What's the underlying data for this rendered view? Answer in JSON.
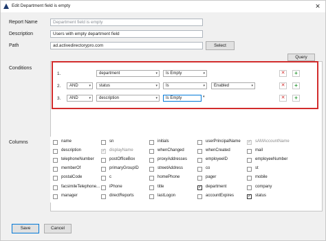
{
  "window": {
    "title": "Edit Department field is empty",
    "close_glyph": "✕"
  },
  "form": {
    "report_name_label": "Report Name",
    "report_name_value": "Department field is empty",
    "description_label": "Description",
    "description_value": "Users with empty department field",
    "path_label": "Path",
    "path_value": "ad.activedirectorypro.com",
    "select_button": "Select",
    "query_button": "Query",
    "conditions_label": "Conditions",
    "columns_label": "Columns"
  },
  "conditions": [
    {
      "num": "1.",
      "join": "",
      "field": "department",
      "operator": "Is Empty",
      "value": "",
      "value_type": "combo"
    },
    {
      "num": "2.",
      "join": "AND",
      "field": "status",
      "operator": "Is",
      "value": "Enabled",
      "value_type": "combo"
    },
    {
      "num": "3.",
      "join": "AND",
      "field": "description",
      "operator": "Is Empty",
      "value": "",
      "value_type": "text"
    }
  ],
  "condition_buttons": {
    "delete_glyph": "✕",
    "add_glyph": "+"
  },
  "columns": [
    [
      {
        "name": "name",
        "checked": false,
        "disabled": false
      },
      {
        "name": "description",
        "checked": false,
        "disabled": false
      },
      {
        "name": "telephoneNumber",
        "checked": false,
        "disabled": false
      },
      {
        "name": "memberOf",
        "checked": false,
        "disabled": false
      },
      {
        "name": "postalCode",
        "checked": false,
        "disabled": false
      },
      {
        "name": "facsimileTelephone...",
        "checked": false,
        "disabled": false
      },
      {
        "name": "manager",
        "checked": false,
        "disabled": false
      }
    ],
    [
      {
        "name": "sn",
        "checked": false,
        "disabled": false
      },
      {
        "name": "displayName",
        "checked": true,
        "disabled": true
      },
      {
        "name": "postOfficeBox",
        "checked": false,
        "disabled": false
      },
      {
        "name": "primaryGroupID",
        "checked": false,
        "disabled": false
      },
      {
        "name": "c",
        "checked": false,
        "disabled": false
      },
      {
        "name": "iPhone",
        "checked": false,
        "disabled": false
      },
      {
        "name": "directReports",
        "checked": false,
        "disabled": false
      }
    ],
    [
      {
        "name": "initials",
        "checked": false,
        "disabled": false
      },
      {
        "name": "whenChanged",
        "checked": false,
        "disabled": false
      },
      {
        "name": "proxyAddresses",
        "checked": false,
        "disabled": false
      },
      {
        "name": "streetAddress",
        "checked": false,
        "disabled": false
      },
      {
        "name": "homePhone",
        "checked": false,
        "disabled": false
      },
      {
        "name": "title",
        "checked": false,
        "disabled": false
      },
      {
        "name": "lastLogon",
        "checked": false,
        "disabled": false
      }
    ],
    [
      {
        "name": "userPrincipalName",
        "checked": false,
        "disabled": false
      },
      {
        "name": "whenCreated",
        "checked": false,
        "disabled": false
      },
      {
        "name": "employeeID",
        "checked": false,
        "disabled": false
      },
      {
        "name": "co",
        "checked": false,
        "disabled": false
      },
      {
        "name": "pager",
        "checked": false,
        "disabled": false
      },
      {
        "name": "department",
        "checked": true,
        "disabled": false
      },
      {
        "name": "accountExpires",
        "checked": false,
        "disabled": false
      }
    ],
    [
      {
        "name": "sAMAccountName",
        "checked": true,
        "disabled": true
      },
      {
        "name": "mail",
        "checked": false,
        "disabled": false
      },
      {
        "name": "employeeNumber",
        "checked": false,
        "disabled": false
      },
      {
        "name": "st",
        "checked": false,
        "disabled": false
      },
      {
        "name": "mobile",
        "checked": false,
        "disabled": false
      },
      {
        "name": "company",
        "checked": false,
        "disabled": false
      },
      {
        "name": "status",
        "checked": true,
        "disabled": false
      }
    ]
  ],
  "footer": {
    "save_button": "Save",
    "cancel_button": "Cancel"
  },
  "colors": {
    "highlight_frame": "#d22b2b",
    "add_icon": "#2e9b3a",
    "delete_icon": "#d22b2b",
    "focus": "#0078d7",
    "app_icon": "#1e3a6e"
  }
}
